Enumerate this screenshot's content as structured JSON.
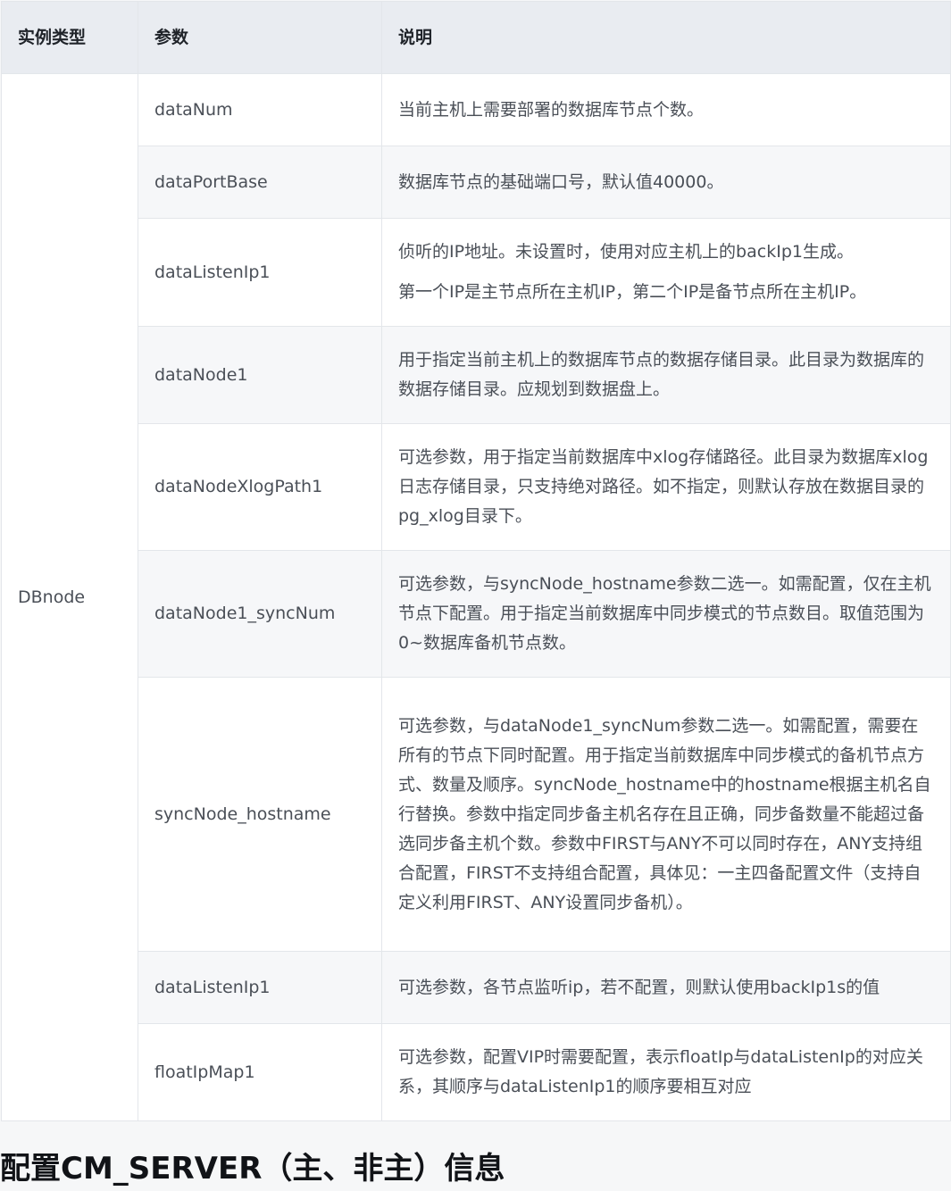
{
  "table": {
    "headers": [
      "实例类型",
      "参数",
      "说明"
    ],
    "instance_type": "DBnode",
    "rows": [
      {
        "param": "dataNum",
        "desc": [
          "当前主机上需要部署的数据库节点个数。"
        ]
      },
      {
        "param": "dataPortBase",
        "desc": [
          "数据库节点的基础端口号，默认值40000。"
        ]
      },
      {
        "param": "dataListenIp1",
        "desc": [
          "侦听的IP地址。未设置时，使用对应主机上的backIp1生成。",
          "第一个IP是主节点所在主机IP，第二个IP是备节点所在主机IP。"
        ]
      },
      {
        "param": "dataNode1",
        "desc": [
          "用于指定当前主机上的数据库节点的数据存储目录。此目录为数据库的数据存储目录。应规划到数据盘上。"
        ]
      },
      {
        "param": "dataNodeXlogPath1",
        "desc": [
          "可选参数，用于指定当前数据库中xlog存储路径。此目录为数据库xlog日志存储目录，只支持绝对路径。如不指定，则默认存放在数据目录的pg_xlog目录下。"
        ]
      },
      {
        "param": "dataNode1_syncNum",
        "desc": [
          "可选参数，与syncNode_hostname参数二选一。如需配置，仅在主机节点下配置。用于指定当前数据库中同步模式的节点数目。取值范围为0~数据库备机节点数。"
        ]
      },
      {
        "param": "syncNode_hostname",
        "desc": [
          "可选参数，与dataNode1_syncNum参数二选一。如需配置，需要在所有的节点下同时配置。用于指定当前数据库中同步模式的备机节点方式、数量及顺序。syncNode_hostname中的hostname根据主机名自行替换。参数中指定同步备主机名存在且正确，同步备数量不能超过备选同步备主机个数。参数中FIRST与ANY不可以同时存在，ANY支持组合配置，FIRST不支持组合配置，具体见：一主四备配置文件（支持自定义利用FIRST、ANY设置同步备机）。"
        ]
      },
      {
        "param": "dataListenIp1",
        "desc": [
          "可选参数，各节点监听ip，若不配置，则默认使用backIp1s的值"
        ]
      },
      {
        "param": "floatIpMap1",
        "desc": [
          "可选参数，配置VIP时需要配置，表示floatIp与dataListenIp的对应关系，其顺序与dataListenIp1的顺序要相互对应"
        ]
      }
    ]
  },
  "section_heading": "配置CM_SERVER（主、非主）信息"
}
